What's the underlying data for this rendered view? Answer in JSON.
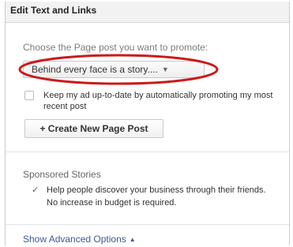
{
  "header": {
    "title": "Edit Text and Links"
  },
  "promote": {
    "label": "Choose the Page post you want to promote:",
    "selected_post": "Behind every face is a story....",
    "caret_icon": "▼",
    "highlight_color": "#cc1a1a"
  },
  "options": {
    "auto_update_label": "Keep my ad up-to-date by automatically promoting my most recent post",
    "auto_update_checked": false,
    "create_post_label": "+ Create New Page Post"
  },
  "sponsored": {
    "title": "Sponsored Stories",
    "text": "Help people discover your business through their friends. No increase in budget is required.",
    "checked": true
  },
  "advanced": {
    "label": "Show Advanced Options",
    "arrow_icon": "▲",
    "link_color": "#3b5998"
  }
}
